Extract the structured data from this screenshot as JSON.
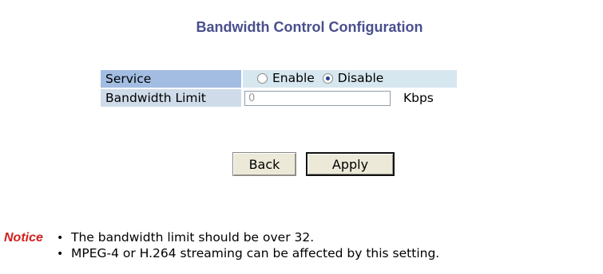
{
  "title": "Bandwidth Control Configuration",
  "service": {
    "label": "Service",
    "options": [
      {
        "label": "Enable",
        "selected": false
      },
      {
        "label": "Disable",
        "selected": true
      }
    ]
  },
  "bandwidth": {
    "label": "Bandwidth Limit",
    "value": "0",
    "unit": "Kbps"
  },
  "buttons": {
    "back": "Back",
    "apply": "Apply"
  },
  "notice": {
    "label": "Notice",
    "items": [
      "The bandwidth limit should be over 32.",
      "MPEG-4 or H.264 streaming can be affected by this setting."
    ]
  },
  "colors": {
    "title": "#4a4f8c",
    "notice_label": "#d0201e",
    "service_label_bg": "#a3bde2",
    "service_value_bg": "#d7e7ef",
    "bandwidth_label_bg": "#cfdbe8"
  }
}
